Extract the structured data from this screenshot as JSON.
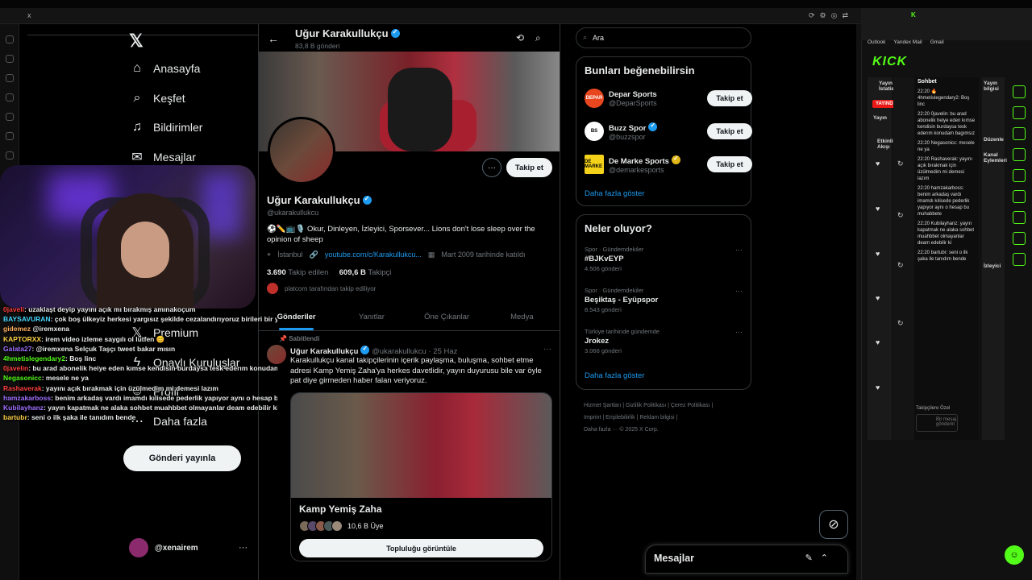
{
  "browser": {
    "tab_label": "x",
    "kick_tabs": "K"
  },
  "nav": {
    "logo": "𝕏",
    "items": [
      {
        "label": "Anasayfa",
        "icon": "home-icon",
        "glyph": "⌂"
      },
      {
        "label": "Keşfet",
        "icon": "search-icon",
        "glyph": "⌕"
      },
      {
        "label": "Bildirimler",
        "icon": "bell-icon",
        "glyph": "♫"
      },
      {
        "label": "Mesajlar",
        "icon": "mail-icon",
        "glyph": "✉"
      },
      {
        "label": "Premium",
        "icon": "x-icon",
        "glyph": "𝕏"
      },
      {
        "label": "Onaylı Kuruluşlar",
        "icon": "lightning-icon",
        "glyph": "ϟ"
      },
      {
        "label": "Profil",
        "icon": "profile-icon",
        "glyph": "☺"
      },
      {
        "label": "Daha fazla",
        "icon": "more-icon",
        "glyph": "⋯"
      }
    ],
    "post_button": "Gönderi yayınla",
    "account_handle": "@xenairem",
    "account_more": "···"
  },
  "profile": {
    "header_name": "Uğur Karakullukçu",
    "header_count": "83,8 B gönderi",
    "name": "Uğur Karakullukçu",
    "handle": "@ukarakullukcu",
    "bio": "⚽✏️📺🎙️ Okur, Dinleyen, İzleyici, Sporsever... Lions don't lose sleep over the opinion of sheep",
    "location": "İstanbul",
    "link": "youtube.com/c/Karakullukcu...",
    "joined": "Mart 2009 tarihinde katıldı",
    "following_count": "3.690",
    "following_label": "Takip edilen",
    "followers_count": "609,6 B",
    "followers_label": "Takipçi",
    "followed_by": "platcorn tarafından takip ediliyor",
    "follow_button": "Takip et",
    "more_button": "···"
  },
  "tabs": [
    "Gönderiler",
    "Yanıtlar",
    "Öne Çıkanlar",
    "Medya"
  ],
  "tweet": {
    "pinned_label": "Sabitlendi",
    "author": "Uğur Karakullukçu",
    "handle": "@ukarakullukcu",
    "date": "· 25 Haz",
    "text": "Karakullukçu kanal takipçilerinin içerik paylaşma, buluşma, sohbet etme adresi Kamp Yemiş Zaha'ya herkes davetlidir, yayın duyurusu bile var öyle pat diye girmeden haber falan veriyoruz.",
    "card_title": "Kamp Yemiş Zaha",
    "card_members": "10,6 B Üye",
    "card_button": "Topluluğu görüntüle"
  },
  "search": {
    "placeholder": "Ara"
  },
  "suggestions": {
    "title": "Bunları beğenebilirsin",
    "items": [
      {
        "name": "Depar Sports",
        "handle": "@DeparSports",
        "logo": "DEPAR",
        "color": "#e8461e",
        "verified": ""
      },
      {
        "name": "Buzz Spor",
        "handle": "@buzzspor",
        "logo": "BS",
        "color": "#ffffff",
        "verified": "blue"
      },
      {
        "name": "De Marke Sports",
        "handle": "@demarkesports",
        "logo": "DE MARKE",
        "color": "#f4d21a",
        "verified": "gold"
      }
    ],
    "follow_label": "Takip et",
    "more": "Daha fazla göster"
  },
  "trends": {
    "title": "Neler oluyor?",
    "items": [
      {
        "category": "Spor · Gündemdekiler",
        "topic": "#BJKvEYP",
        "count": "4.506 gönderi"
      },
      {
        "category": "Spor · Gündemdekiler",
        "topic": "Beşiktaş - Eyüpspor",
        "count": "8.543 gönderi"
      },
      {
        "category": "Türkiye tarihinde gündemde",
        "topic": "Jrokez",
        "count": "3.066 gönderi"
      }
    ],
    "more": "Daha fazla göster"
  },
  "footer": {
    "line1": "Hizmet Şartları | Gizlilik Politikası | Çerez Politikası |",
    "line2": "Imprint | Erişilebilirlik | Reklam bilgisi |",
    "line3": "Daha fazla ··· © 2025 X Corp."
  },
  "messages_drawer": {
    "title": "Mesajlar"
  },
  "stream_chat": [
    {
      "user": "0javeli",
      "text": ": uzaklaşt deyip yayını açık mı bırakmış amınakoçum",
      "c": "nm5"
    },
    {
      "user": "BAYSAVURAN",
      "text": ": çok boş ülkeyiz herkesi yargısız şekilde cezalandırıyoruz birileri bir yoldan gidiyor diye herkes aynı yol",
      "c": "nm6"
    },
    {
      "user": "gidemez",
      "text": " @iremxena",
      "c": "nm7"
    },
    {
      "user": "KAPTORXX",
      "text": ": irem video izleme saygılı ol lütfen 😊",
      "c": "nm3"
    },
    {
      "user": "Galata27",
      "text": ": @iremxena Selçuk Taşçı tweet bakar mısın",
      "c": "nm4"
    },
    {
      "user": "4hmetislegendary2",
      "text": ": Boş linc",
      "c": "nm1"
    },
    {
      "user": "0javelin",
      "text": ": bu arad abonelik heiye eden kımse kendisin burdaysa tesk ederım konudam bagımsız",
      "c": "nm5"
    },
    {
      "user": "Negasonicc",
      "text": ": mesele ne ya",
      "c": "nm1"
    },
    {
      "user": "Rashaverak",
      "text": ": yayını açık bırakmak için üzülmedim mi demesi lazım",
      "c": "nm5"
    },
    {
      "user": "hamzakarboss",
      "text": ": benim arkadaş vardı imamdı kılisede pederlik yapıyor aynı o hesap bu muhabbete",
      "c": "nm4"
    },
    {
      "user": "Kubilayhanz",
      "text": ": yayın kapatmak ne alaka sohbet muahbbet olmayanlar deam edebilir ki",
      "c": "nm4"
    },
    {
      "user": "bartubr",
      "text": ": seni o ilk şaka ile tanıdım bende",
      "c": "nm3"
    }
  ],
  "kick": {
    "logo": "KICK",
    "bookmarks": [
      "Outlook",
      "Yandex Mail",
      "Gmail"
    ],
    "stats_label": "Yayın İstatistikleri",
    "live_badge": "YAYINDA",
    "yayin_label": "Yayın",
    "activity_label": "Etkinlik Akışı",
    "chat_title": "Sohbet",
    "chat_lines": [
      "22:20 🔥 4hmetislegendary2: Boş linc",
      "22:20 0javelin: bu arad abonelik heiye eden kımse kendisin burdaysa tesk ederım konudam bagımsız",
      "22:20 Negasonicc: mesele ne ya",
      "22:20 Rashaverak: yayını açık bırakmak için üzülmedim mi demesi lazım",
      "22:20 hamzakarboss: benim arkadaş vardı imamdı kılisede pederlik yapıyor aynı o hesap bu muhabbete",
      "22:20 Kubilayhanz: yayın kapatmak ne alaka sohbet muahbbet olmayanlar deam edebilir ki",
      "22:20 bartubr: seni o ilk şaka ile tanıdım bende"
    ],
    "chat_input": "Bir mesaj gönderin",
    "followers_only": "Takipçilere Özel",
    "side_label_1": "Yayın bilgisi",
    "side_label_2": "Düzenle",
    "side_label_3": "Kanal Eylemleri",
    "side_label_4": "İzleyici"
  }
}
